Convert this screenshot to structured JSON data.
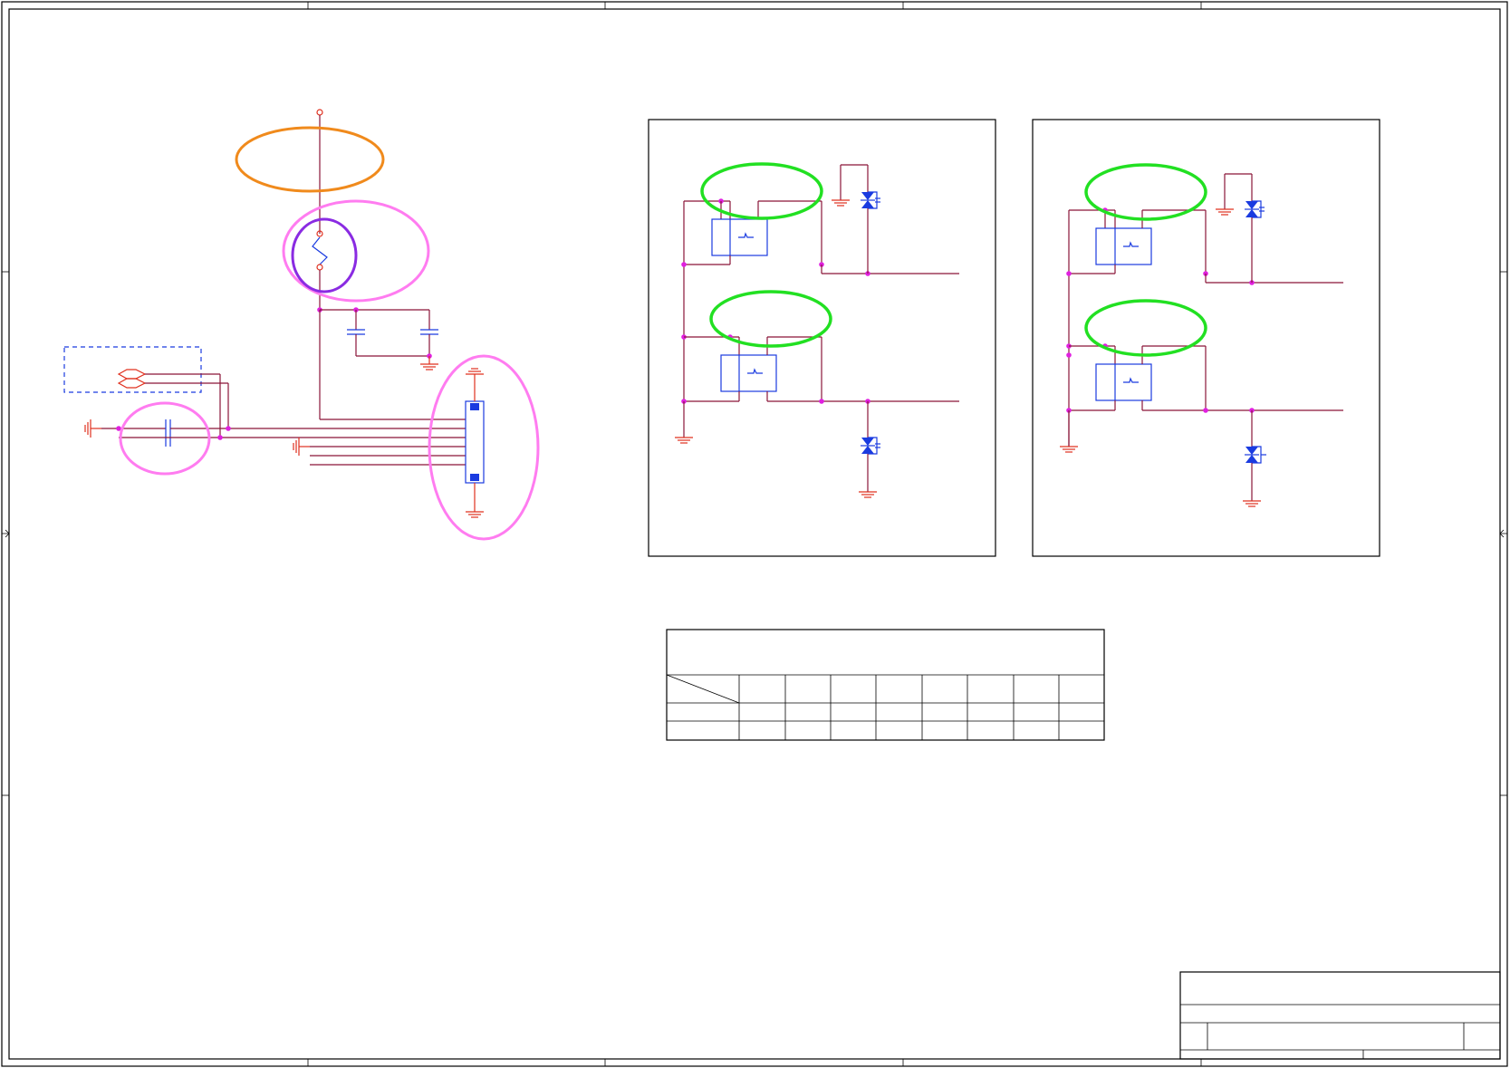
{
  "diagram": {
    "type": "electrical-schematic-sheet",
    "colors": {
      "frame": "#000000",
      "wire": "#8a1538",
      "component": "#1a3be0",
      "ground": "#e0301e",
      "junction": "#e020e0",
      "highlight_orange": "#f08a1c",
      "highlight_pink": "#ff7cf0",
      "highlight_purple": "#8a2be2",
      "highlight_green": "#22e022"
    },
    "icons": [
      "ground-symbol",
      "capacitor",
      "fuse",
      "tvs-diode",
      "optocoupler",
      "connector",
      "antenna-plug"
    ],
    "highlights": {
      "orange": 1,
      "pink": 3,
      "purple": 1,
      "green": 4
    },
    "table": {
      "rows": 3,
      "columns": 9
    }
  }
}
